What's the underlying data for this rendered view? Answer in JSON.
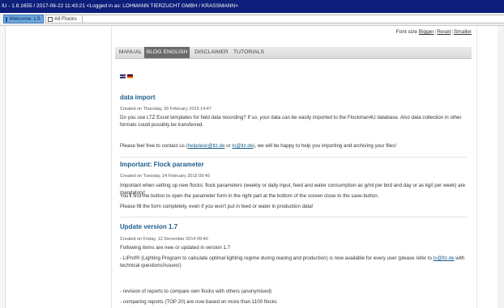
{
  "titlebar": {
    "text": "IU - 1.8.1655 / 2017-06-22 11:43:21 <Logged in as: LOHMANN TIERZUCHT GMBH / KRASSMANN>"
  },
  "tabs": [
    {
      "label": "Welcome: LS",
      "active": true
    },
    {
      "label": "All Flocks",
      "active": false
    }
  ],
  "fontsize": {
    "label": "Font size",
    "bigger": "Bigger",
    "reset": "Reset",
    "smaller": "Smaller"
  },
  "nav": {
    "items": [
      {
        "label": "MANUAL"
      },
      {
        "label": "BLOG ENGLISH"
      },
      {
        "label": "DISCLAIMER"
      },
      {
        "label": "TUTORIALS"
      }
    ]
  },
  "posts": [
    {
      "title": "data import",
      "date": "Created on Thursday, 26 February 2015 14:47",
      "p1": "Do you use LTZ Excel templates for field data recording? If so, your data can be easily imported to the Flockman4U database. Also data collection in other formats could possibly be transferred.",
      "p2_before": "Please feel free to contact us (",
      "p2_link1": "helpdesk@ltz.de",
      "p2_mid": " or ",
      "p2_link2": "ts@ltz.de",
      "p2_after": "), we will be happy to help you importing and archiving your files!"
    },
    {
      "title": "Important: Flock parameter",
      "date": "Created on Tuesday, 24 February 2015 09:45",
      "p1": "Important when setting up new flocks: flock parameters (weekly or daily input, feed and water consumption as g/ml per bird and day or as kg/l per week) are mandatory!",
      "p2": "You'll find the button to open the parameter form in the right part at the bottom of the screen close to the save-button.",
      "p3": "Please fill the form completely, even if you won't put in feed or water in production data!"
    },
    {
      "title": "Update version 1.7",
      "date": "Created on Friday, 12 December 2014 09:40",
      "p1": "Following items are new or updated in version 1.7",
      "p2_before": "- LiProf® (Lighting Program to calculate optimal lighting regime during rearing and production) is now available for every user (please refer to ",
      "p2_link": "ts@ltz.de",
      "p2_after": " with technical questions/issues!)",
      "p3": "- revision of reports to compare own flocks with others (anonymised)",
      "p4": "- comparing reports (TOP 20) are now based on more than 1100 flocks"
    }
  ]
}
